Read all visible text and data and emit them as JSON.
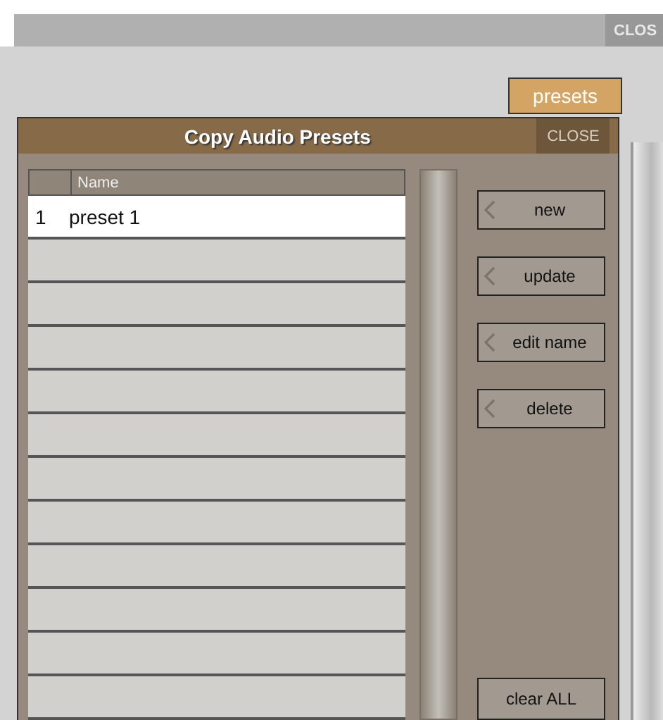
{
  "top_bar": {
    "close": "CLOS"
  },
  "presets_button": "presets",
  "dialog": {
    "title": "Copy Audio Presets",
    "close": "CLOSE",
    "table": {
      "columns": [
        "Name"
      ],
      "rows": [
        {
          "index": "1",
          "name": "preset 1",
          "selected": true
        },
        {
          "selected": false
        },
        {
          "selected": false
        },
        {
          "selected": false
        },
        {
          "selected": false
        },
        {
          "selected": false
        },
        {
          "selected": false
        },
        {
          "selected": false
        },
        {
          "selected": false
        },
        {
          "selected": false
        },
        {
          "selected": false
        },
        {
          "selected": false
        }
      ]
    },
    "actions": [
      "new",
      "update",
      "edit name",
      "delete"
    ],
    "clear_button": "clear ALL"
  }
}
